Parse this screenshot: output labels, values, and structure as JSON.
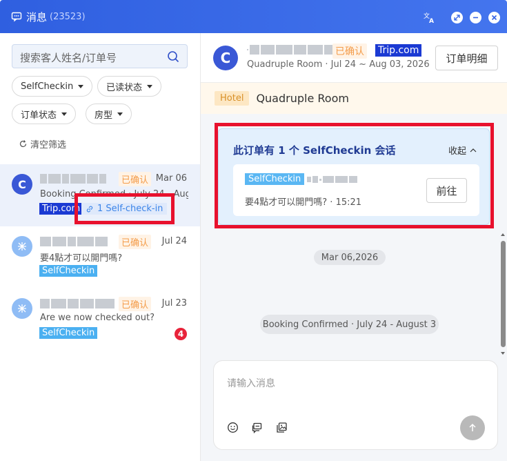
{
  "window": {
    "title": "消息",
    "count": "(23523)"
  },
  "sidebar": {
    "search_placeholder": "搜索客人姓名/订单号",
    "filters": [
      {
        "label": "SelfCheckin"
      },
      {
        "label": "已读状态"
      },
      {
        "label": "订单状态"
      },
      {
        "label": "房型"
      }
    ],
    "clear_label": "清空筛选",
    "conversations": [
      {
        "avatar": "C",
        "status": "已确认",
        "date": "Mar 06",
        "preview": "Booking Confirmed · July 24 - Aug...",
        "tag": "Trip.com",
        "link_label": "1 Self-check-in"
      },
      {
        "status": "已确认",
        "date": "Jul 24",
        "preview": "要4點才可以開門嗎?",
        "tag": "SelfCheckin"
      },
      {
        "status": "已确认",
        "date": "Jul 23",
        "preview": "Are we now checked out?",
        "tag": "SelfCheckin",
        "unread": "4"
      }
    ]
  },
  "chat": {
    "avatar": "C",
    "status": "已确认",
    "channel": "Trip.com",
    "subtitle": "Quadruple Room · Jul 24 ~ Aug 03, 2026",
    "detail_button": "订单明细",
    "room_tag": "Hotel",
    "room_name": "Quadruple Room",
    "selfcheckin_card": {
      "heading": "此订单有 1 个 SelfCheckin 会话",
      "fold_label": "收起",
      "tag": "SelfCheckin",
      "message": "要4點才可以開門嗎? · 15:21",
      "go_button": "前往"
    },
    "date_divider": "Mar 06,2026",
    "system_message": "Booking Confirmed · July 24 - August 3",
    "input_placeholder": "请输入消息"
  },
  "colors": {
    "titlebar": "#3563e4",
    "highlight_red": "#e8112d",
    "confirmed": "#f49c4a",
    "trip_tag": "#1b3ad3",
    "selfcheckin_tag": "#4bb0f1"
  }
}
